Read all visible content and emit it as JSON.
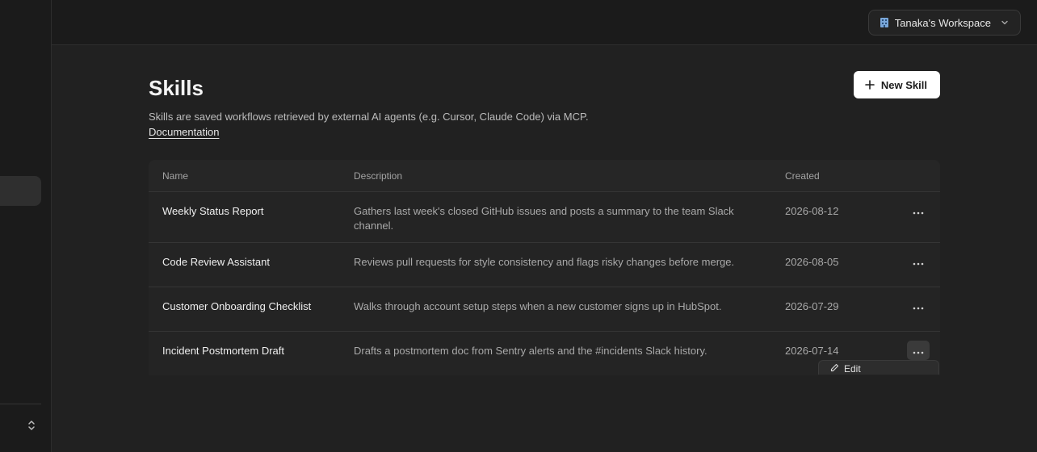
{
  "topbar": {
    "workspace_label": "Tanaka's Workspace"
  },
  "page": {
    "title": "Skills",
    "description": "Skills are saved workflows retrieved by external AI agents (e.g. Cursor, Claude Code) via MCP.",
    "doc_link": "Documentation",
    "new_button": "New Skill"
  },
  "table": {
    "columns": [
      "Name",
      "Description",
      "Created"
    ],
    "rows": [
      {
        "name": "Weekly Status Report",
        "description": "Gathers last week's closed GitHub issues and posts a summary to the team Slack channel.",
        "created": "2026-08-12"
      },
      {
        "name": "Code Review Assistant",
        "description": "Reviews pull requests for style consistency and flags risky changes before merge.",
        "created": "2026-08-05"
      },
      {
        "name": "Customer Onboarding Checklist",
        "description": "Walks through account setup steps when a new customer signs up in HubSpot.",
        "created": "2026-07-29"
      },
      {
        "name": "Incident Postmortem Draft",
        "description": "Drafts a postmortem doc from Sentry alerts and the #incidents Slack history.",
        "created": "2026-07-14"
      }
    ]
  },
  "menu": {
    "edit_label": "Edit"
  },
  "icons": {
    "workspace": "building-icon",
    "chevron": "chevron-down-icon",
    "plus": "plus-icon",
    "more": "more-horizontal-icon",
    "edit": "pencil-icon",
    "sidebar_toggle": "chevrons-up-down-icon"
  },
  "colors": {
    "background": "#212121",
    "surface": "#242424",
    "primary_button": "#ffffff"
  }
}
